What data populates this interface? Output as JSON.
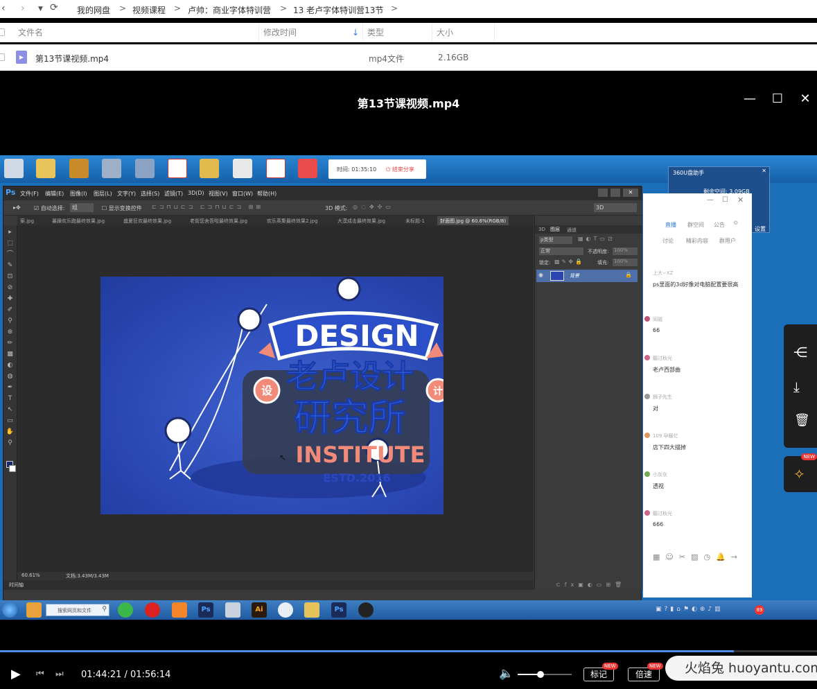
{
  "breadcrumb": {
    "items": [
      "我的网盘",
      "视频课程",
      "卢帅：商业字体特训营",
      "13 老卢字体特训营13节"
    ],
    "separator": ">"
  },
  "file_list": {
    "columns": [
      "文件名",
      "修改时间",
      "类型",
      "大小"
    ],
    "rows": [
      {
        "name": "第13节课视频.mp4",
        "type": "mp4文件",
        "size": "2.16GB"
      }
    ]
  },
  "player": {
    "title": "第13节课视频.mp4",
    "current_time": "01:44:21",
    "total_time": "01:56:14",
    "time_display": "01:44:21 / 01:56:14",
    "progress": 0.898,
    "volume": 0.42,
    "mark_label": "标记",
    "speed_label": "倍速",
    "new_badge": "NEW"
  },
  "watermark": "火焰兔 huoyantu.com",
  "screen": {
    "recording": {
      "time_label": "时间: 01:35:10",
      "end_share": "结束分享"
    },
    "helper_title": "360U盘助手",
    "helper_space": "剩余空间: 3.09GB",
    "helper_settings": "设置",
    "photoshop": {
      "menu": [
        "文件(F)",
        "编辑(E)",
        "图像(I)",
        "图层(L)",
        "文字(Y)",
        "选择(S)",
        "滤镜(T)",
        "3D(D)",
        "视图(V)",
        "窗口(W)",
        "帮助(H)"
      ],
      "options": {
        "auto_select": "自动选择:",
        "auto_select_value": "组",
        "show_transform": "显示变换控件",
        "mode_3d": "3D 模式:",
        "workspace": "3D"
      },
      "tabs": [
        "案.jpg",
        "暴躁欢乐跑最终效果.jpg",
        "盛夏狂欢最终效果.jpg",
        "老街您舍吾啦最终效果.jpg",
        "欢乐英集最终效果2.jpg",
        "大漠成击最终效果.jpg",
        "未标题-1",
        "封面图.jpg @ 60.6%(RGB/8)"
      ],
      "status_zoom": "60.61%",
      "status_doc": "文档:3.43M/3.43M",
      "timeline": "时间轴",
      "layers_tabs": [
        "3D",
        "图层",
        "通道"
      ],
      "layer_kind": "ρ类型",
      "blend_mode": "正常",
      "opacity_label": "不透明度:",
      "opacity_value": "100%",
      "lock_label": "锁定:",
      "fill_label": "填充:",
      "fill_value": "100%",
      "layer_name": "背景"
    },
    "artwork": {
      "design": "DESIGN",
      "line1": "老卢设计",
      "line2": "研究所",
      "institute": "INSTITUTE",
      "badge_left": "设",
      "badge_right": "计",
      "est": "ESTD.2016"
    },
    "chat": {
      "tabs": [
        "直播",
        "群空间",
        "公告"
      ],
      "subtabs": [
        "讨论",
        "精彩内容",
        "群用户"
      ],
      "messages": [
        {
          "user": "上大∽XZ",
          "text": "ps里面的3d好像对电脑配置要很高"
        },
        {
          "user": "同磁",
          "text": "66"
        },
        {
          "user": "聽过秋光",
          "text": "老卢西部曲"
        },
        {
          "user": "狮子先生",
          "text": "对"
        },
        {
          "user": "109 孕暖忆",
          "text": "店下四大描掉"
        },
        {
          "user": "小灰灰",
          "text": "透视"
        },
        {
          "user": "聽过秋光",
          "text": "666"
        }
      ]
    },
    "taskbar": {
      "search_placeholder": "搜索网页和文件",
      "notification_count": "89"
    }
  },
  "colors": {
    "accent": "#2e7bd8",
    "canvas_blue": "#2845b0",
    "salmon": "#f28a7a",
    "progress": "#4a90e2"
  }
}
